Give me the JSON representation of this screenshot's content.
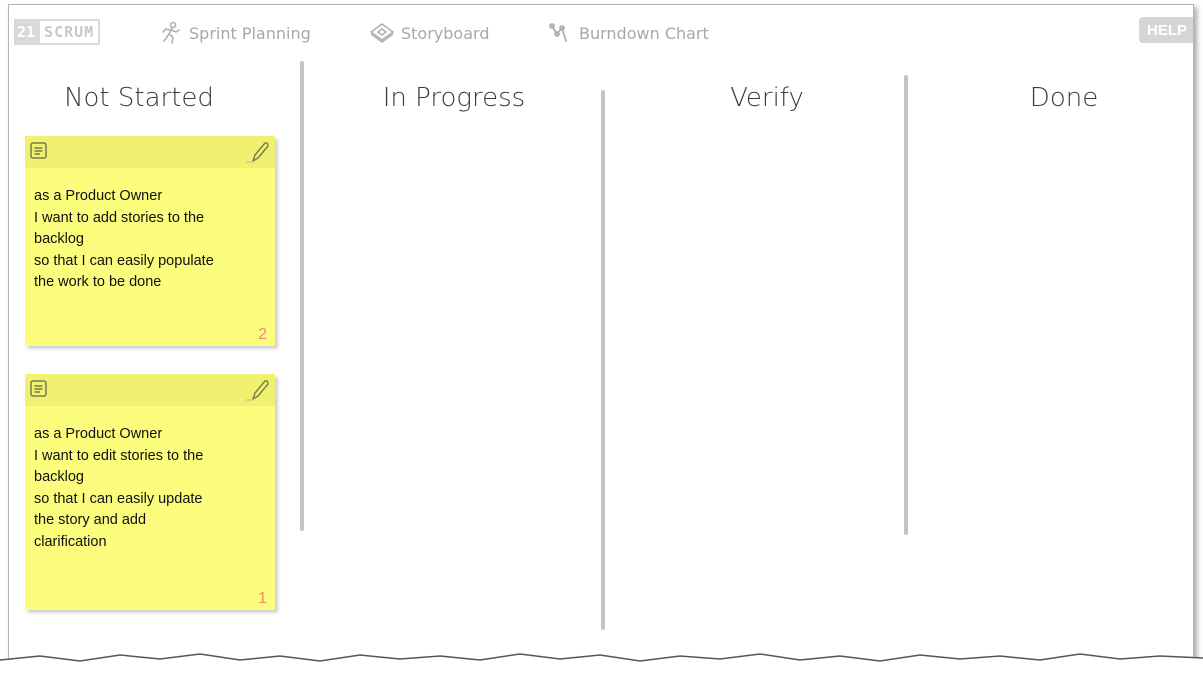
{
  "app": {
    "logo_number": "21",
    "logo_word": "SCRUM",
    "help_label": "HELP"
  },
  "nav": [
    {
      "label": "Sprint Planning",
      "icon": "sprint-planning-icon"
    },
    {
      "label": "Storyboard",
      "icon": "storyboard-icon"
    },
    {
      "label": "Burndown Chart",
      "icon": "burndown-chart-icon"
    }
  ],
  "columns": [
    {
      "title": "Not Started"
    },
    {
      "title": "In Progress"
    },
    {
      "title": "Verify"
    },
    {
      "title": "Done"
    }
  ],
  "notes": [
    {
      "lines": [
        "as a Product Owner",
        "I want to add stories to the",
        "backlog",
        "so that I can easily populate",
        "the work to be done"
      ],
      "points": "2"
    },
    {
      "lines": [
        "as a Product Owner",
        "I want to edit stories to the",
        "backlog",
        "so that I can easily update",
        "the story and add",
        "clarification"
      ],
      "points": "1"
    }
  ],
  "colors": {
    "note_background": "#fcfc7d",
    "note_header": "#f1f171",
    "points_color": "#f08a6e",
    "toolbar_text": "#a8a8a8",
    "divider": "#c4c4c4"
  }
}
